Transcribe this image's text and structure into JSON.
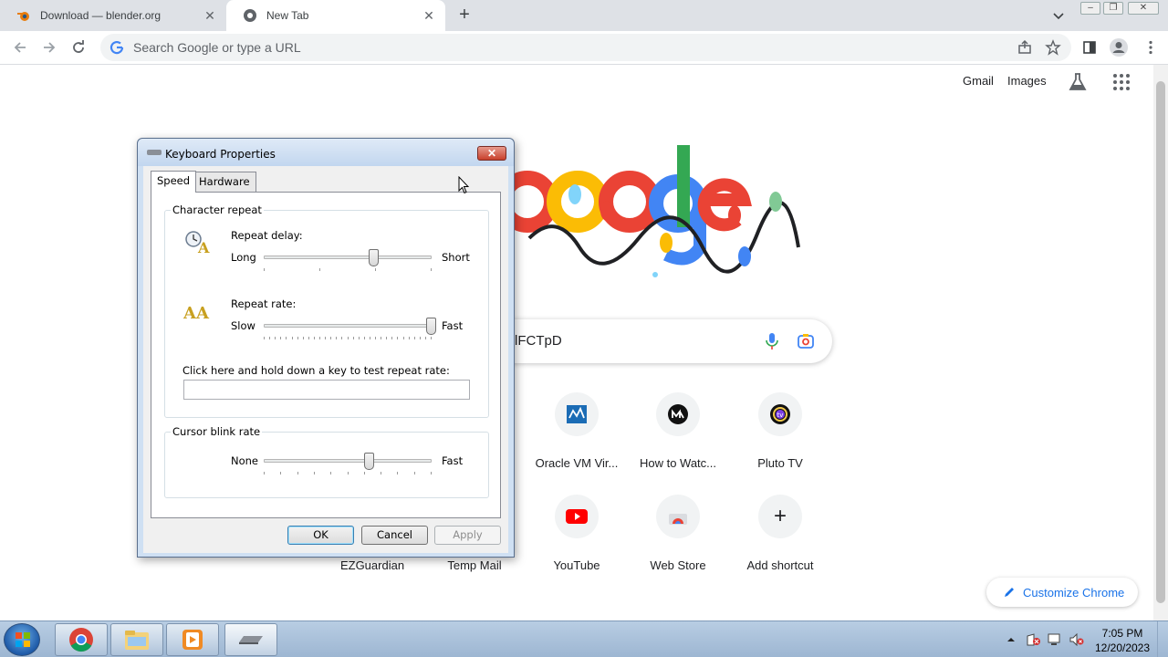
{
  "browser": {
    "tabs": [
      {
        "title": "Download — blender.org",
        "active": false,
        "close": "✕"
      },
      {
        "title": "New Tab",
        "active": true,
        "close": "✕"
      }
    ],
    "new_tab": "+",
    "omnibox_placeholder": "Search Google or type a URL"
  },
  "ntp": {
    "links": {
      "gmail": "Gmail",
      "images": "Images"
    },
    "search_query": "lFCTpD",
    "shortcuts_row1": [
      {
        "label": "Oracle VM Vir...",
        "icon": "virtualbox-icon"
      },
      {
        "label": "How to Watc...",
        "icon": "media-icon"
      },
      {
        "label": "Pluto TV",
        "icon": "plutotv-icon"
      }
    ],
    "shortcuts_row2": [
      {
        "label": "EZGuardian"
      },
      {
        "label": "Temp Mail"
      },
      {
        "label": "YouTube",
        "icon": "youtube-icon"
      },
      {
        "label": "Web Store",
        "icon": "webstore-icon"
      },
      {
        "label": "Add shortcut",
        "icon": "plus-icon",
        "glyph": "+"
      }
    ],
    "customize": "Customize Chrome"
  },
  "dialog": {
    "title": "Keyboard Properties",
    "close": "✕",
    "tabs": [
      "Speed",
      "Hardware"
    ],
    "character_repeat": {
      "group_title": "Character repeat",
      "delay_label": "Repeat delay:",
      "delay_min": "Long",
      "delay_max": "Short",
      "delay_value_fraction": 0.66,
      "rate_label": "Repeat rate:",
      "rate_min": "Slow",
      "rate_max": "Fast",
      "rate_value_fraction": 1.0,
      "test_label": "Click here and hold down a key to test repeat rate:",
      "test_value": ""
    },
    "cursor_blink": {
      "group_title": "Cursor blink rate",
      "min": "None",
      "max": "Fast",
      "value_fraction": 0.63
    },
    "buttons": {
      "ok": "OK",
      "cancel": "Cancel",
      "apply": "Apply"
    }
  },
  "taskbar": {
    "time": "7:05 PM",
    "date": "12/20/2023"
  }
}
